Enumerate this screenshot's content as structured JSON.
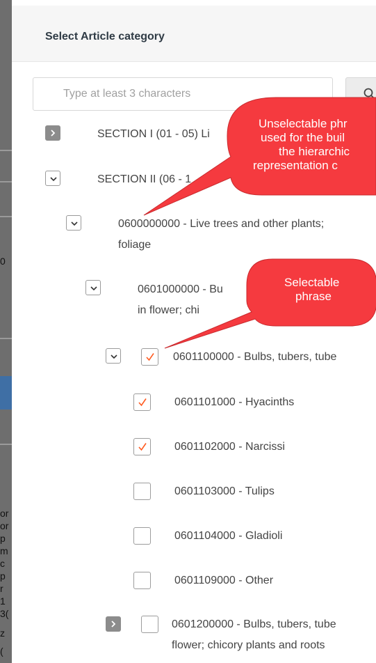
{
  "modal": {
    "title": "Select Article category"
  },
  "search": {
    "placeholder": "Type at least 3 characters",
    "button_icon": "search-icon"
  },
  "tree": {
    "section1": "SECTION I (01 - 05) Li",
    "section2": "SECTION II (06 - 1",
    "chapter06": "0600000000 - Live trees and other plants;",
    "chapter06_cont": "foliage",
    "heading0601": "0601000000 - Bu",
    "heading0601_cont": "in flower; chi",
    "sub06011": "0601100000 - Bulbs, tubers, tube",
    "leaf1": "0601101000 - Hyacinths",
    "leaf2": "0601102000 - Narcissi",
    "leaf3": "0601103000 - Tulips",
    "leaf4": "0601104000 - Gladioli",
    "leaf5": "0601109000 - Other",
    "sub06012": "0601200000 - Bulbs, tubers, tube",
    "sub06012_cont": "flower; chicory plants and roots",
    "checked": {
      "sub06011": true,
      "leaf1": true,
      "leaf2": true,
      "leaf3": false,
      "leaf4": false,
      "leaf5": false,
      "sub06012": false
    }
  },
  "callouts": {
    "unselectable": [
      "Unselectable phr",
      "used for the buil",
      "the hierarchic",
      "representation c"
    ],
    "selectable": [
      "Selectable",
      "phrase"
    ]
  },
  "backdrop_fragments": [
    "0",
    "or",
    "or",
    "p",
    "m",
    "c",
    "p",
    "r",
    "1",
    "3(",
    "z",
    "("
  ],
  "colors": {
    "callout": "#f53a3f",
    "check": "#ff5a1f",
    "toggle_collapsed": "#8c8c8c"
  }
}
